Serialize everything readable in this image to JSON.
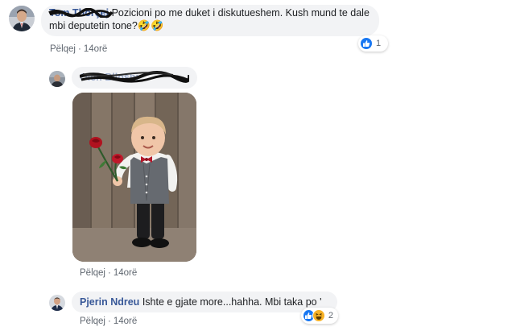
{
  "comments": [
    {
      "author": "Tom Thorçej",
      "text": "Pozicioni po me duket i diskutueshem. Kush mund te dale mbi deputetin tone?",
      "emoji": "🤣🤣",
      "reply_label": "Pëlqej",
      "separator": "·",
      "time": "14orë",
      "reaction_count": "1"
    },
    {
      "author": "Olen Blloshi",
      "reply_label": "Pëlqej",
      "separator": "·",
      "time": "14orë"
    },
    {
      "author": "Pjerin Ndreu",
      "text": "Ishte e gjate more...hahha. Mbi taka po '",
      "reply_label": "Pëlqej",
      "separator": "·",
      "time": "14orë",
      "reaction_count": "2"
    }
  ],
  "colors": {
    "link_blue": "#385898",
    "bubble_bg": "#f2f3f5",
    "meta_gray": "#606770",
    "like_blue": "#1877f2",
    "haha_yellow": "#f7b125"
  },
  "icons": {
    "like": "like-reaction-icon",
    "haha": "haha-reaction-icon"
  }
}
